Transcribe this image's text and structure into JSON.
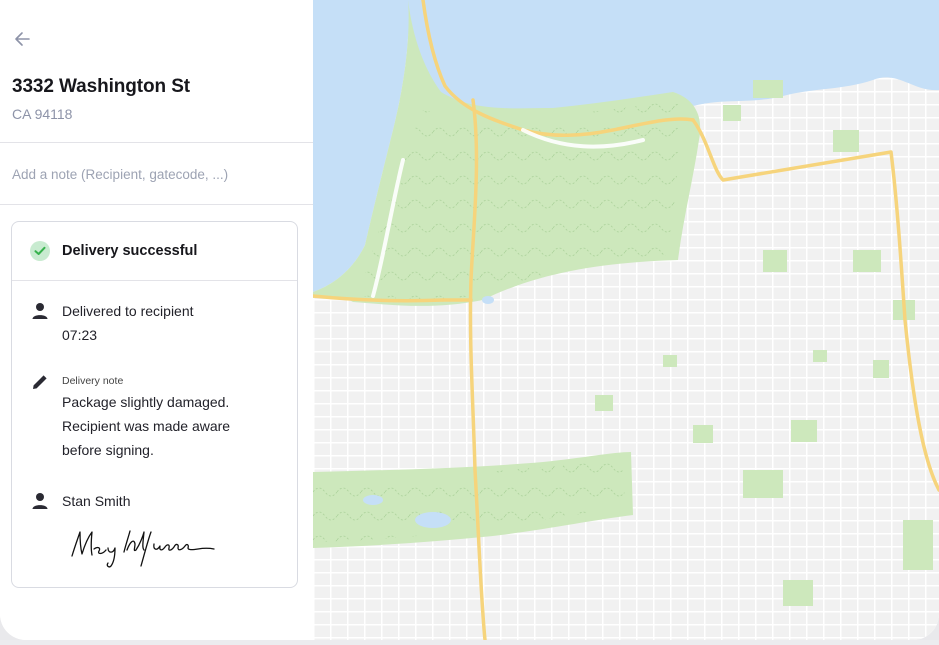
{
  "header": {
    "back_icon": "arrow-left-icon",
    "address_line1": "3332 Washington St",
    "address_line2": "CA 94118"
  },
  "note": {
    "placeholder": "Add a note (Recipient, gatecode, ...)",
    "value": ""
  },
  "delivery": {
    "status_icon": "check-circle-icon",
    "status": "Delivery successful",
    "recipient_label": "Delivered to recipient",
    "time": "07:23",
    "note_label": "Delivery note",
    "note_lines": [
      "Package slightly damaged.",
      "Recipient was made aware",
      "before signing."
    ],
    "signer_name": "Stan Smith",
    "signature_text": "Mey Whyuan"
  },
  "colors": {
    "water": "#c5dff7",
    "park": "#cde8bc",
    "land": "#f2f2f2",
    "highway": "#f6d47c",
    "success": "#37b24d"
  }
}
